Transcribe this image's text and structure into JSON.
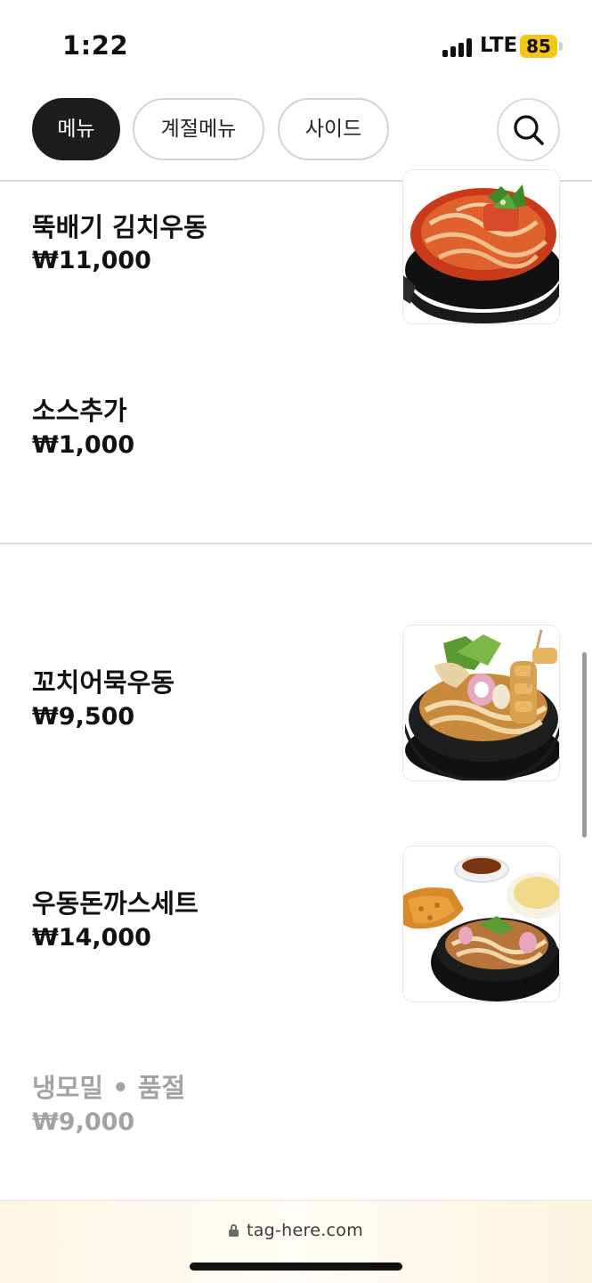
{
  "status_bar": {
    "time": "1:22",
    "network": "LTE",
    "battery": "85",
    "battery_color": "#f5c518"
  },
  "tabs": [
    {
      "label": "메뉴",
      "active": true
    },
    {
      "label": "계절메뉴",
      "active": false
    },
    {
      "label": "사이드",
      "active": false
    }
  ],
  "search": {
    "icon": "search-icon"
  },
  "menu": {
    "items": [
      {
        "name": "뚝배기 김치우동",
        "price": "₩11,000",
        "image": "kimchi-udon-photo"
      },
      {
        "name": "소스추가",
        "price": "₩1,000"
      },
      {
        "name": "꼬치어묵우동",
        "price": "₩9,500",
        "image": "fishcake-udon-photo"
      },
      {
        "name": "우동돈까스세트",
        "price": "₩14,000",
        "image": "udon-cutlet-set-photo"
      },
      {
        "name": "냉모밀 • 품절",
        "price": "₩9,000",
        "sold_out": true
      }
    ]
  },
  "browser": {
    "url": "tag-here.com",
    "icon": "lock-icon"
  },
  "colors": {
    "active_tab": "#1d1d1f",
    "text": "#111111",
    "sold_out_text": "#a3a3a3",
    "divider": "#d9d9d9"
  }
}
